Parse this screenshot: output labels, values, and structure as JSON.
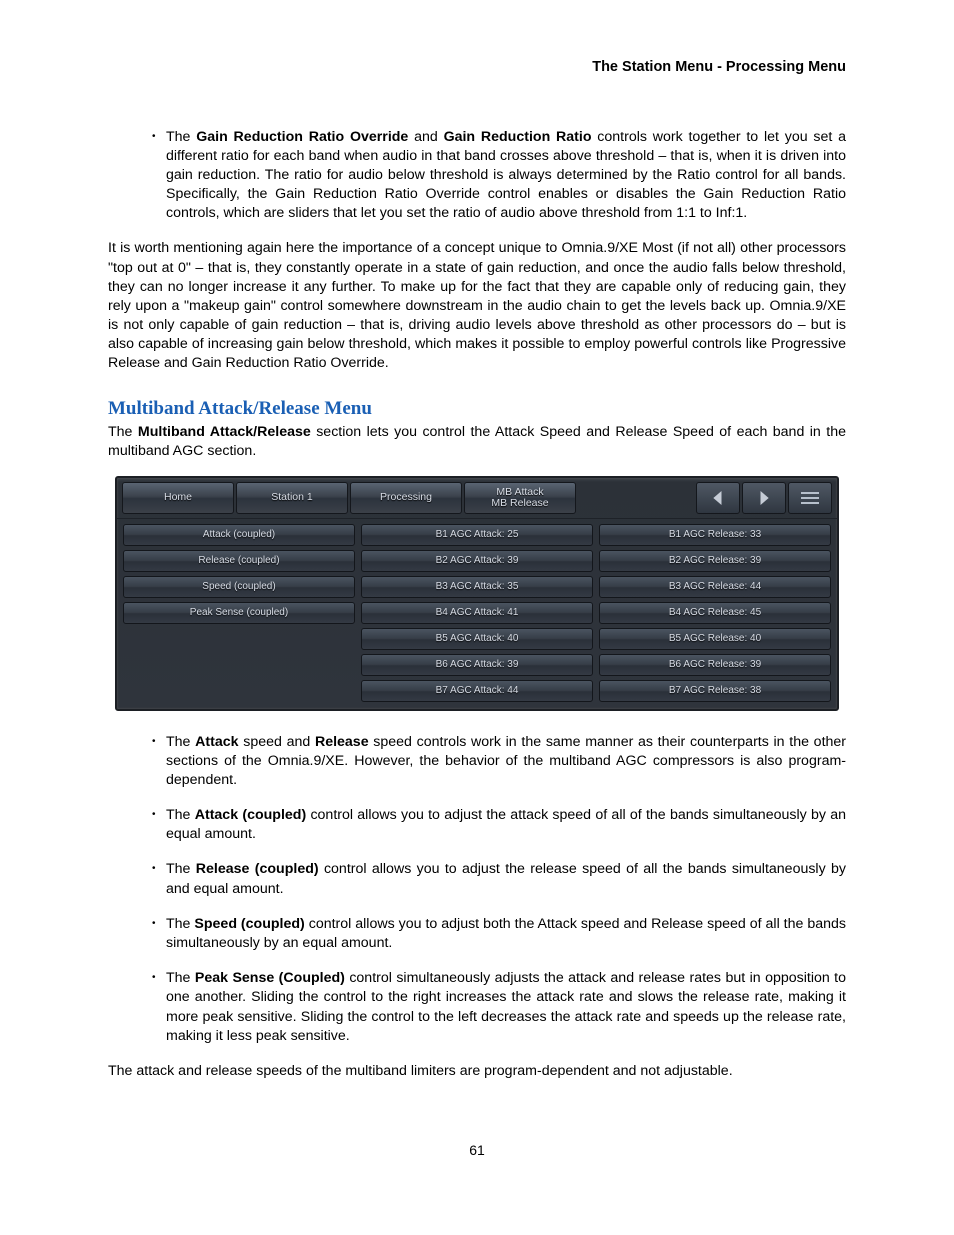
{
  "header": "The Station Menu - Processing Menu",
  "p_override": "The <b>Gain Reduction Ratio Override</b> and <b>Gain Reduction Ratio</b> controls work together to let you set a different ratio for each band when audio in that band crosses above threshold – that is, when it is driven into gain reduction. The ratio for audio below threshold is always determined by the Ratio control for all bands. Specifically, the Gain Reduction Ratio Override control enables or disables the Gain Reduction Ratio controls, which are sliders that let you set the ratio of audio above threshold from 1:1 to Inf:1.",
  "p_mention": "It is worth mentioning again here the importance of a concept unique to Omnia.9/XE Most (if not all) other processors \"top out at 0\" – that is, they constantly operate in a state of gain reduction, and once the audio falls below threshold, they can no longer increase it any further. To make up for the fact that they are capable only of reducing gain, they rely upon a \"makeup gain\" control somewhere downstream in the audio chain to get the levels back up. Omnia.9/XE is not only capable of gain reduction – that is, driving audio levels above threshold as other processors do – but is also capable of increasing gain below threshold, which makes it possible to employ powerful controls like Progressive Release and Gain Reduction Ratio Override.",
  "section_heading": "Multiband Attack/Release Menu",
  "p_section_intro": "The <b>Multiband Attack/Release</b> section lets you control the Attack Speed and Release Speed of each band in the multiband AGC section.",
  "breadcrumbs": [
    "Home",
    "Station 1",
    "Processing"
  ],
  "bc_mb_top": "MB Attack",
  "bc_mb_bottom": "MB Release",
  "col_left": [
    "Attack (coupled)",
    "Release (coupled)",
    "Speed (coupled)",
    "Peak Sense (coupled)"
  ],
  "col_attack": [
    "B1 AGC Attack: 25",
    "B2 AGC Attack: 39",
    "B3 AGC Attack: 35",
    "B4 AGC Attack: 41",
    "B5 AGC Attack: 40",
    "B6 AGC Attack: 39",
    "B7 AGC Attack: 44"
  ],
  "col_release": [
    "B1 AGC Release: 33",
    "B2 AGC Release: 39",
    "B3 AGC Release: 44",
    "B4 AGC Release: 45",
    "B5 AGC Release: 40",
    "B6 AGC Release: 39",
    "B7 AGC Release: 38"
  ],
  "bullets": [
    "The <b>Attack</b> speed and <b>Release</b> speed controls work in the same manner as their counterparts in the other sections of the Omnia.9/XE. However, the behavior of the multiband AGC compressors is also program-dependent.",
    "The <b>Attack (coupled)</b> control allows you to adjust the attack speed of all of the bands simultaneously by an equal amount.",
    "The <b>Release (coupled)</b> control allows you to adjust the release speed of all the bands simultaneously by and equal amount.",
    "The <b>Speed (coupled)</b> control allows you to adjust both the Attack speed and Release speed of all the bands simultaneously by an equal amount.",
    "The <b>Peak Sense (Coupled)</b> control simultaneously adjusts the attack and release rates but in opposition to one another. Sliding the control to the right increases the attack rate and slows the release rate, making it more peak sensitive. Sliding the control to the left decreases the attack rate and speeds up the release rate, making it less peak sensitive."
  ],
  "p_footer": "The attack and release speeds of the multiband limiters are program-dependent and not adjustable.",
  "page_num": "61"
}
